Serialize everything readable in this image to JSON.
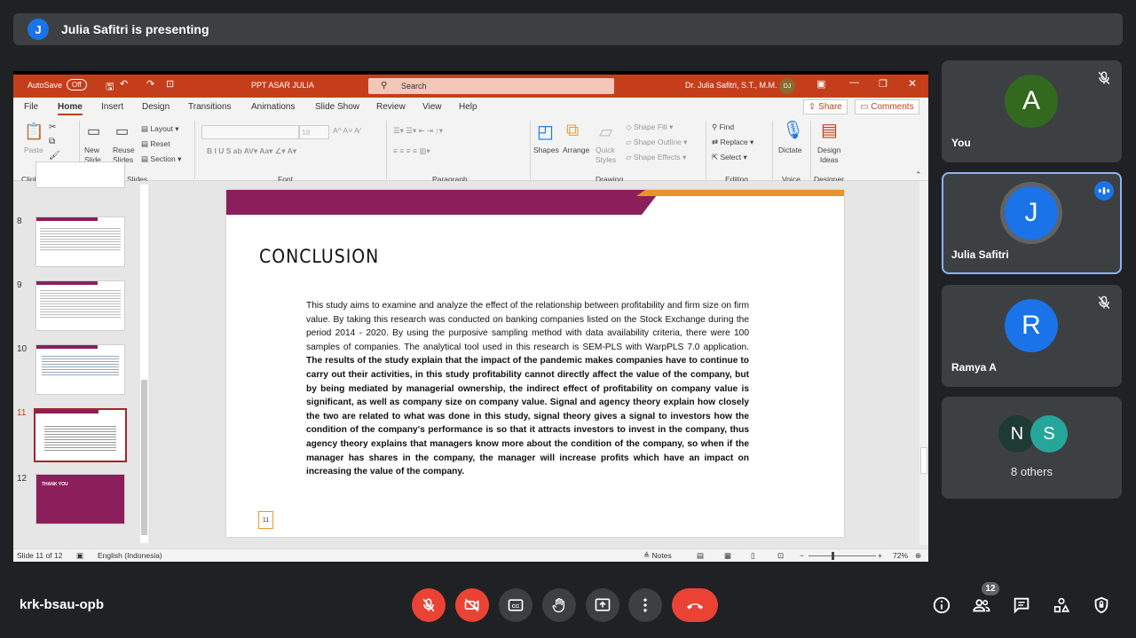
{
  "banner": {
    "avatar_letter": "J",
    "text": "Julia Safitri is presenting"
  },
  "ppt": {
    "autosave_label": "AutoSave",
    "autosave_state": "Off",
    "doc_title": "PPT ASAR JULIA",
    "search_placeholder": "Search",
    "user_name": "Dr. Julia Safitri, S.T., M.M.",
    "user_initials": "DJ",
    "tabs": [
      "File",
      "Home",
      "Insert",
      "Design",
      "Transitions",
      "Animations",
      "Slide Show",
      "Review",
      "View",
      "Help"
    ],
    "share_label": "Share",
    "comments_label": "Comments",
    "ribbon": {
      "paste": "Paste",
      "new_slide": "New\nSlide",
      "reuse_slides": "Reuse\nSlides",
      "layout": "Layout",
      "reset": "Reset",
      "section": "Section",
      "font_size": "18",
      "shapes": "Shapes",
      "arrange": "Arrange",
      "quick_styles": "Quick\nStyles",
      "shape_fill": "Shape Fill",
      "shape_outline": "Shape Outline",
      "shape_effects": "Shape Effects",
      "find": "Find",
      "replace": "Replace",
      "select": "Select",
      "dictate": "Dictate",
      "design_ideas": "Design\nIdeas",
      "groups": {
        "clipboard": "Clipboard",
        "slides": "Slides",
        "font": "Font",
        "paragraph": "Paragraph",
        "drawing": "Drawing",
        "editing": "Editing",
        "voice": "Voice",
        "designer": "Designer"
      }
    },
    "thumb_numbers": [
      "8",
      "9",
      "10",
      "11",
      "12"
    ],
    "thumb12_text": "THANK YOU",
    "slide": {
      "title": "CONCLUSION",
      "body_plain": "This study aims to examine and analyze the effect of the relationship between profitability and firm size on firm value. By taking this research was conducted on banking companies listed on the Stock Exchange during the period 2014 - 2020. By using the purposive sampling method with data availability criteria, there were 100 samples of companies. The analytical tool used in this research is SEM-PLS with WarpPLS 7.0 application. ",
      "body_bold": "The results of the study explain that the impact of the pandemic makes companies have to continue to carry out their activities, in this study profitability cannot directly affect the value of the company, but by being mediated by managerial ownership, the indirect effect of profitability on company value is significant, as well as company size on company value. Signal and agency theory explain how closely the two are related to what was done in this study, signal theory gives a signal to investors how the condition of the company's performance is so that it attracts investors to invest in the company, thus agency theory explains that managers know more about the condition of the company, so when if the manager has shares in the company, the manager will increase profits which have an impact on increasing the value of the company.",
      "page_number": "11"
    },
    "status": {
      "slide_of": "Slide 11 of 12",
      "language": "English (Indonesia)",
      "notes": "Notes",
      "zoom": "72%"
    }
  },
  "participants": [
    {
      "letter": "A",
      "name": "You",
      "color": "#33691e"
    },
    {
      "letter": "J",
      "name": "Julia Safitri",
      "color": "#1a73e8"
    },
    {
      "letter": "R",
      "name": "Ramya A",
      "color": "#1a73e8"
    }
  ],
  "others": {
    "letters": [
      "N",
      "S"
    ],
    "colors": [
      "#1e3a34",
      "#26a69a"
    ],
    "label": "8 others"
  },
  "bottom": {
    "meeting_code": "krk-bsau-opb",
    "participant_count": "12"
  },
  "icons": [
    "mic-off-icon",
    "camera-off-icon",
    "captions-icon",
    "raise-hand-icon",
    "present-icon",
    "more-icon",
    "end-call-icon",
    "info-icon",
    "people-icon",
    "chat-icon",
    "activities-icon",
    "host-controls-icon"
  ]
}
